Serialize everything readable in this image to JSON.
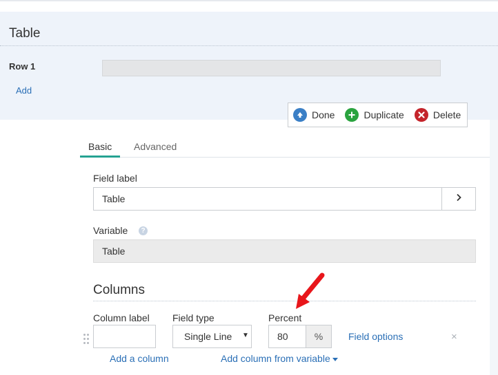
{
  "section": {
    "title": "Table",
    "row_label": "Row 1",
    "add_label": "Add"
  },
  "toolbar": {
    "done_label": "Done",
    "duplicate_label": "Duplicate",
    "delete_label": "Delete",
    "colors": {
      "done": "#3a7fc6",
      "duplicate": "#2aa33f",
      "delete": "#c4242b"
    }
  },
  "tabs": [
    {
      "label": "Basic",
      "active": true
    },
    {
      "label": "Advanced",
      "active": false
    }
  ],
  "field_label": {
    "title": "Field label",
    "value": "Table",
    "button_icon": "chevron-right-icon"
  },
  "variable": {
    "title": "Variable",
    "help_icon": "question-circle-icon",
    "value": "Table"
  },
  "columns": {
    "title": "Columns",
    "headers": {
      "column_label": "Column label",
      "field_type": "Field type",
      "percent": "Percent"
    },
    "row": {
      "column_label_value": "",
      "field_type_value": "Single Line",
      "percent_value": "80",
      "percent_addon": "%",
      "field_options_label": "Field options",
      "remove_label": "×"
    },
    "add_column_label": "Add a column",
    "add_from_variable_label": "Add column from variable"
  },
  "annotation": {
    "arrow_color": "#e8161b"
  }
}
